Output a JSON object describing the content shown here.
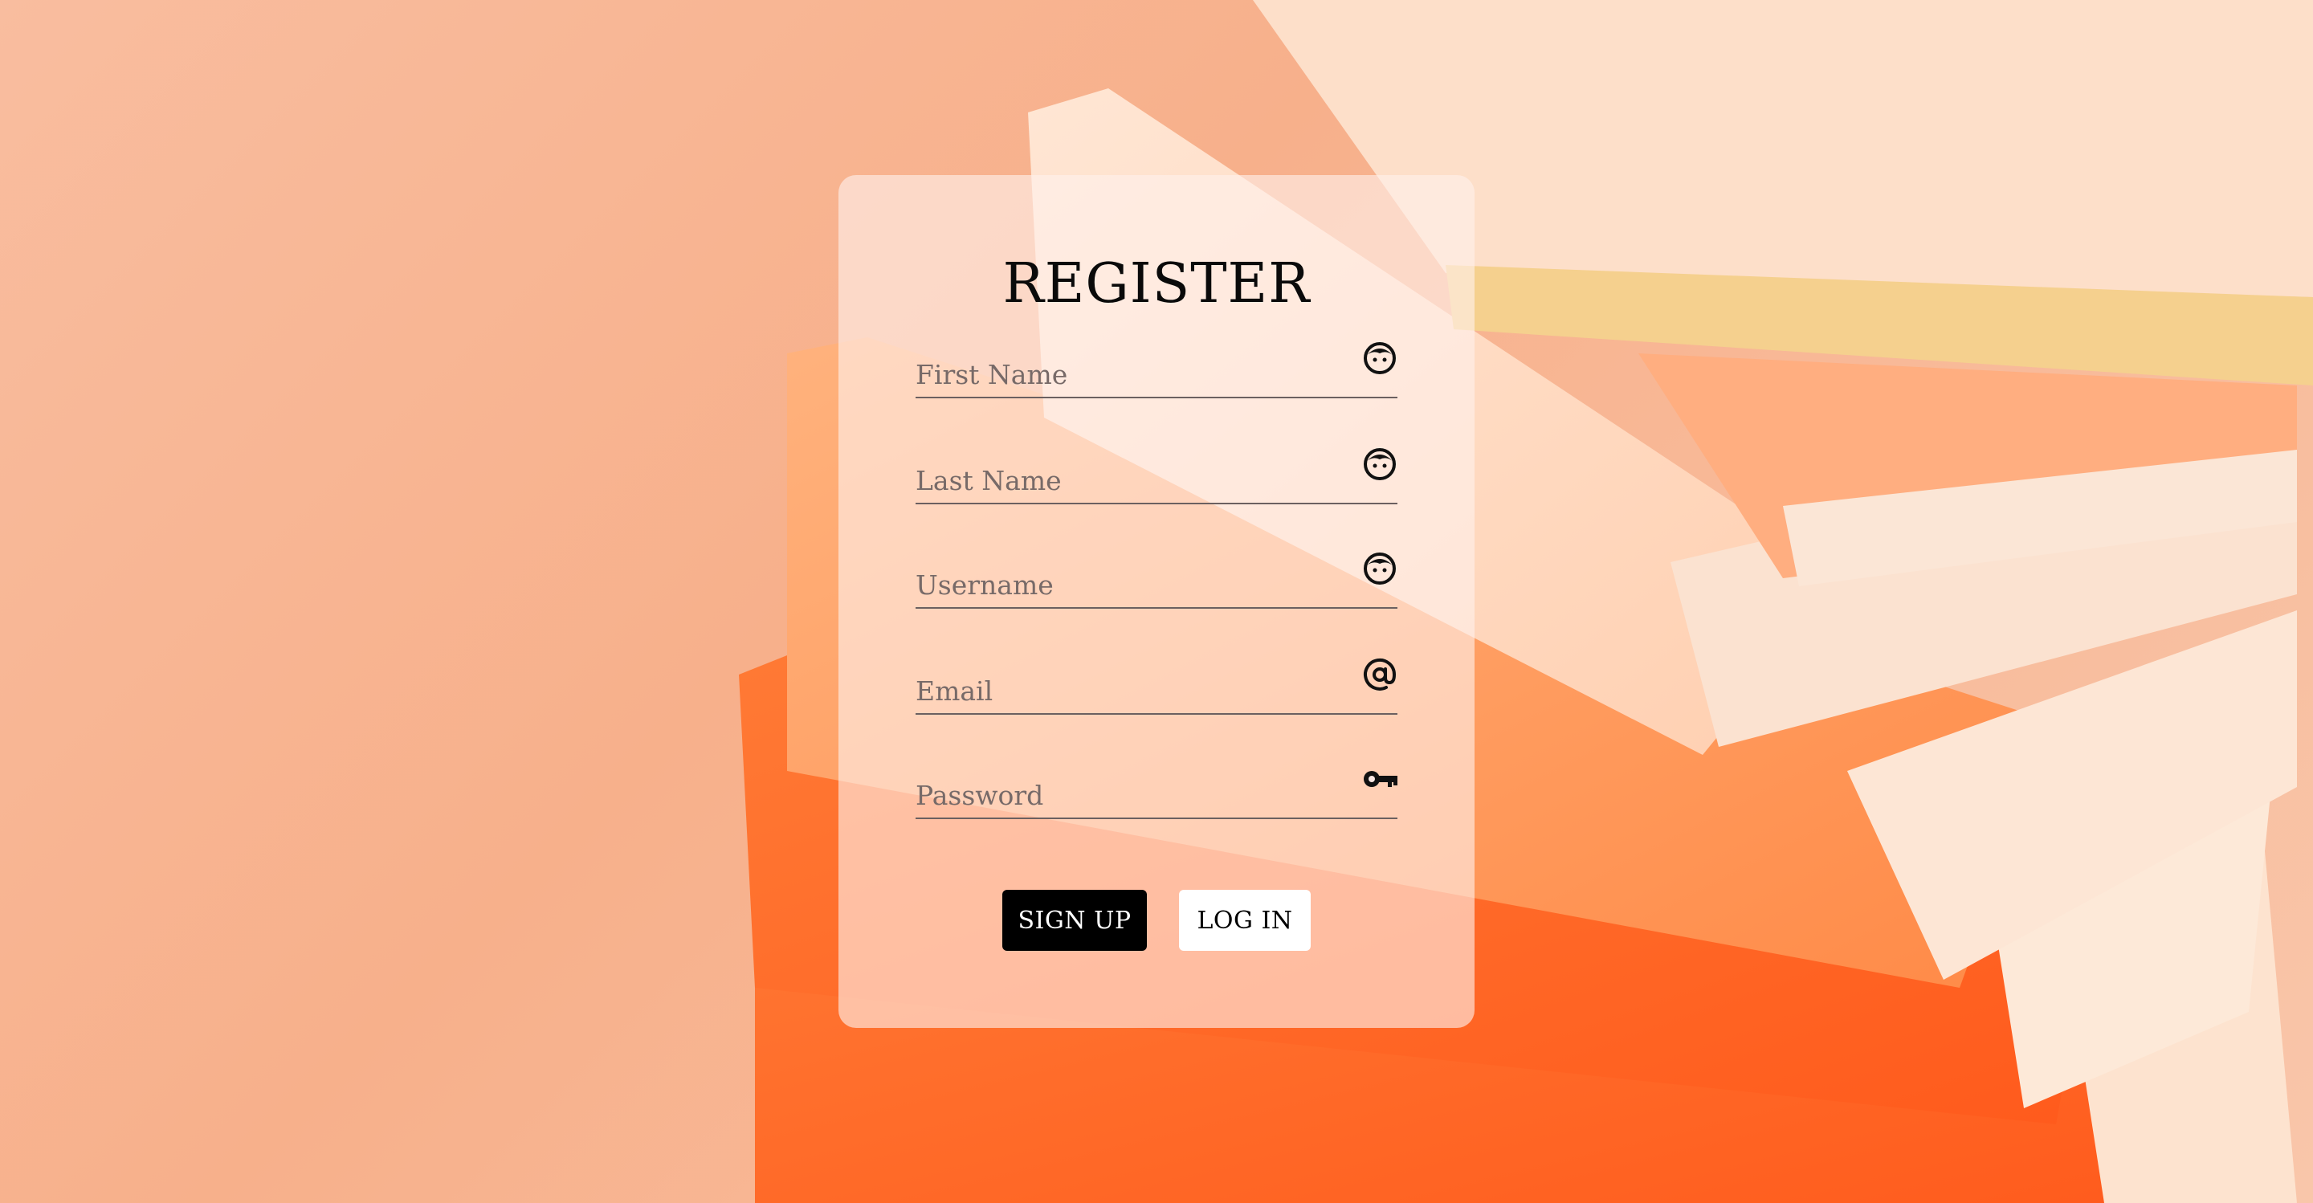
{
  "form": {
    "title": "REGISTER",
    "fields": [
      {
        "placeholder": "First Name",
        "value": "",
        "icon": "face-icon"
      },
      {
        "placeholder": "Last Name",
        "value": "",
        "icon": "face-icon"
      },
      {
        "placeholder": "Username",
        "value": "",
        "icon": "face-icon"
      },
      {
        "placeholder": "Email",
        "value": "",
        "icon": "at-sign-icon"
      },
      {
        "placeholder": "Password",
        "value": "",
        "icon": "key-icon"
      }
    ],
    "signup_label": "SIGN UP",
    "login_label": "LOG IN"
  },
  "colors": {
    "background": "#f9bd9f",
    "book_orange": "#ff6a2a",
    "book_pages": "#fde3cf",
    "card": "#fff0ec",
    "primary_button": "#000000",
    "secondary_button": "#ffffff"
  }
}
